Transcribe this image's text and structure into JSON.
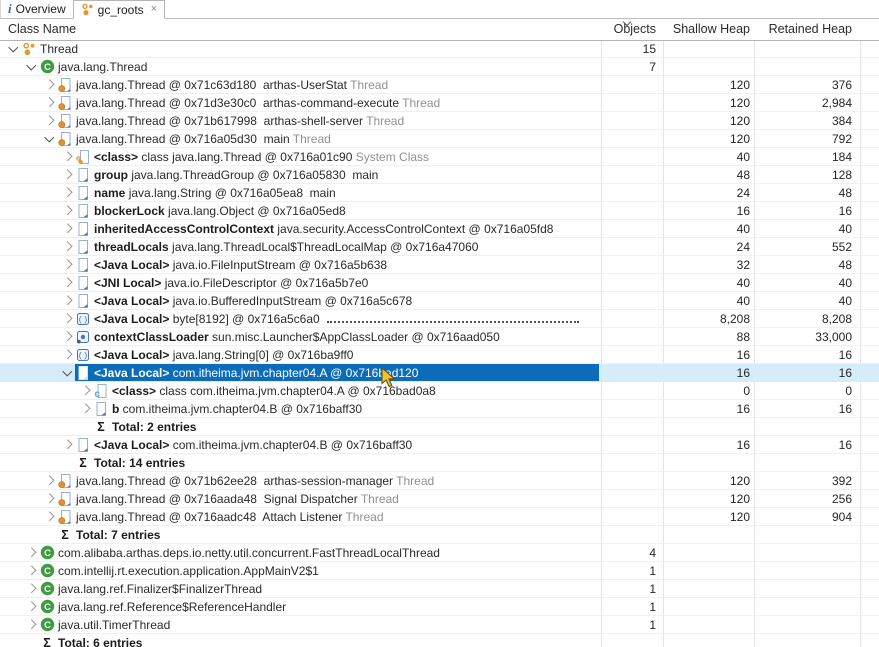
{
  "tabs": [
    {
      "label": "Overview",
      "icon": "info-icon",
      "active": false,
      "closable": false
    },
    {
      "label": "gc_roots",
      "icon": "gc-roots-icon",
      "active": true,
      "closable": true,
      "close_label": "×"
    }
  ],
  "columns": [
    {
      "label": "Class Name"
    },
    {
      "label": "Objects"
    },
    {
      "label": "Shallow Heap"
    },
    {
      "label": "Retained Heap"
    }
  ],
  "sort_indicator_column": "Objects",
  "colors": {
    "selection_dark": "#0c6cba",
    "selection_light": "#d5edfa",
    "gc_roots_orange": "#df9a33",
    "class_green": "#3f9b3f",
    "icon_blue": "#4a76b8",
    "muted_text": "#919191"
  },
  "rows": [
    {
      "level": 0,
      "expand": "expanded",
      "icon": "gc-roots",
      "segments": [
        [
          "n",
          "Thread"
        ]
      ],
      "objects": "15",
      "shallow": "",
      "retained": ""
    },
    {
      "level": 1,
      "expand": "expanded",
      "icon": "class-green",
      "segments": [
        [
          "n",
          "java.lang.Thread"
        ]
      ],
      "objects": "7",
      "shallow": "",
      "retained": ""
    },
    {
      "level": 2,
      "expand": "collapsed",
      "icon": "thread",
      "segments": [
        [
          "n",
          "java.lang.Thread @ 0x71c63d180  arthas-UserStat"
        ],
        [
          "g",
          " Thread"
        ]
      ],
      "objects": "",
      "shallow": "120",
      "retained": "376"
    },
    {
      "level": 2,
      "expand": "collapsed",
      "icon": "thread",
      "segments": [
        [
          "n",
          "java.lang.Thread @ 0x71d3e30c0  arthas-command-execute"
        ],
        [
          "g",
          " Thread"
        ]
      ],
      "objects": "",
      "shallow": "120",
      "retained": "2,984"
    },
    {
      "level": 2,
      "expand": "collapsed",
      "icon": "thread",
      "segments": [
        [
          "n",
          "java.lang.Thread @ 0x71b617998  arthas-shell-server"
        ],
        [
          "g",
          " Thread"
        ]
      ],
      "objects": "",
      "shallow": "120",
      "retained": "384"
    },
    {
      "level": 2,
      "expand": "expanded",
      "icon": "thread",
      "segments": [
        [
          "n",
          "java.lang.Thread @ 0x716a05d30  main"
        ],
        [
          "g",
          " Thread"
        ]
      ],
      "objects": "",
      "shallow": "120",
      "retained": "792"
    },
    {
      "level": 3,
      "expand": "collapsed",
      "icon": "sysclass",
      "segments": [
        [
          "b",
          "<class> "
        ],
        [
          "n",
          "class java.lang.Thread @ 0x716a01c90 "
        ],
        [
          "g",
          "System Class"
        ]
      ],
      "objects": "",
      "shallow": "40",
      "retained": "184"
    },
    {
      "level": 3,
      "expand": "collapsed",
      "icon": "object",
      "segments": [
        [
          "b",
          "group "
        ],
        [
          "n",
          "java.lang.ThreadGroup @ 0x716a05830  main"
        ]
      ],
      "objects": "",
      "shallow": "48",
      "retained": "128"
    },
    {
      "level": 3,
      "expand": "collapsed",
      "icon": "object",
      "segments": [
        [
          "b",
          "name "
        ],
        [
          "n",
          "java.lang.String @ 0x716a05ea8  main"
        ]
      ],
      "objects": "",
      "shallow": "24",
      "retained": "48"
    },
    {
      "level": 3,
      "expand": "collapsed",
      "icon": "object",
      "segments": [
        [
          "b",
          "blockerLock "
        ],
        [
          "n",
          "java.lang.Object @ 0x716a05ed8"
        ]
      ],
      "objects": "",
      "shallow": "16",
      "retained": "16"
    },
    {
      "level": 3,
      "expand": "collapsed",
      "icon": "object",
      "segments": [
        [
          "b",
          "inheritedAccessControlContext "
        ],
        [
          "n",
          "java.security.AccessControlContext @ 0x716a05fd8"
        ]
      ],
      "objects": "",
      "shallow": "40",
      "retained": "40"
    },
    {
      "level": 3,
      "expand": "collapsed",
      "icon": "object",
      "segments": [
        [
          "b",
          "threadLocals "
        ],
        [
          "n",
          "java.lang.ThreadLocal$ThreadLocalMap @ 0x716a47060"
        ]
      ],
      "objects": "",
      "shallow": "24",
      "retained": "552"
    },
    {
      "level": 3,
      "expand": "collapsed",
      "icon": "object",
      "segments": [
        [
          "b",
          "<Java Local> "
        ],
        [
          "n",
          "java.io.FileInputStream @ 0x716a5b638"
        ]
      ],
      "objects": "",
      "shallow": "32",
      "retained": "48"
    },
    {
      "level": 3,
      "expand": "collapsed",
      "icon": "object",
      "segments": [
        [
          "b",
          "<JNI Local> "
        ],
        [
          "n",
          "java.io.FileDescriptor @ 0x716a5b7e0"
        ]
      ],
      "objects": "",
      "shallow": "40",
      "retained": "40"
    },
    {
      "level": 3,
      "expand": "collapsed",
      "icon": "object",
      "segments": [
        [
          "b",
          "<Java Local> "
        ],
        [
          "n",
          "java.io.BufferedInputStream @ 0x716a5c678"
        ]
      ],
      "objects": "",
      "shallow": "40",
      "retained": "40"
    },
    {
      "level": 3,
      "expand": "collapsed",
      "icon": "array",
      "segments": [
        [
          "b",
          "<Java Local> "
        ],
        [
          "n",
          "byte[8192] @ 0x716a5c6a0 "
        ]
      ],
      "dots": true,
      "objects": "",
      "shallow": "8,208",
      "retained": "8,208"
    },
    {
      "level": 3,
      "expand": "collapsed",
      "icon": "classloader",
      "segments": [
        [
          "b",
          "contextClassLoader "
        ],
        [
          "n",
          "sun.misc.Launcher$AppClassLoader @ 0x716aad050"
        ]
      ],
      "objects": "",
      "shallow": "88",
      "retained": "33,000"
    },
    {
      "level": 3,
      "expand": "collapsed",
      "icon": "array",
      "segments": [
        [
          "b",
          "<Java Local> "
        ],
        [
          "n",
          "java.lang.String[0] @ 0x716ba9ff0"
        ]
      ],
      "objects": "",
      "shallow": "16",
      "retained": "16"
    },
    {
      "level": 3,
      "expand": "expanded",
      "icon": "object-white",
      "selected": true,
      "segments": [
        [
          "b",
          "<Java Local> "
        ],
        [
          "n",
          "com.itheima.jvm.chapter04.A @ 0x716bad120"
        ]
      ],
      "objects": "",
      "shallow": "16",
      "retained": "16"
    },
    {
      "level": 4,
      "expand": "collapsed",
      "icon": "class-blue",
      "segments": [
        [
          "b",
          "<class> "
        ],
        [
          "n",
          "class com.itheima.jvm.chapter04.A @ 0x716bad0a8"
        ]
      ],
      "objects": "",
      "shallow": "0",
      "retained": "0"
    },
    {
      "level": 4,
      "expand": "collapsed",
      "icon": "object",
      "segments": [
        [
          "b",
          "b "
        ],
        [
          "n",
          "com.itheima.jvm.chapter04.B @ 0x716baff30"
        ]
      ],
      "objects": "",
      "shallow": "16",
      "retained": "16"
    },
    {
      "level": 4,
      "expand": "none",
      "icon": "sigma",
      "segments": [
        [
          "b",
          "Total: 2 entries"
        ]
      ],
      "objects": "",
      "shallow": "",
      "retained": ""
    },
    {
      "level": 3,
      "expand": "collapsed",
      "icon": "object",
      "segments": [
        [
          "b",
          "<Java Local> "
        ],
        [
          "n",
          "com.itheima.jvm.chapter04.B @ 0x716baff30"
        ]
      ],
      "objects": "",
      "shallow": "16",
      "retained": "16"
    },
    {
      "level": 3,
      "expand": "none",
      "icon": "sigma",
      "segments": [
        [
          "b",
          "Total: 14 entries"
        ]
      ],
      "objects": "",
      "shallow": "",
      "retained": ""
    },
    {
      "level": 2,
      "expand": "collapsed",
      "icon": "thread",
      "segments": [
        [
          "n",
          "java.lang.Thread @ 0x71b62ee28  arthas-session-manager"
        ],
        [
          "g",
          " Thread"
        ]
      ],
      "objects": "",
      "shallow": "120",
      "retained": "392"
    },
    {
      "level": 2,
      "expand": "collapsed",
      "icon": "thread",
      "segments": [
        [
          "n",
          "java.lang.Thread @ 0x716aada48  Signal Dispatcher"
        ],
        [
          "g",
          " Thread"
        ]
      ],
      "objects": "",
      "shallow": "120",
      "retained": "256"
    },
    {
      "level": 2,
      "expand": "collapsed",
      "icon": "thread",
      "segments": [
        [
          "n",
          "java.lang.Thread @ 0x716aadc48  Attach Listener"
        ],
        [
          "g",
          " Thread"
        ]
      ],
      "objects": "",
      "shallow": "120",
      "retained": "904"
    },
    {
      "level": 2,
      "expand": "none",
      "icon": "sigma",
      "segments": [
        [
          "b",
          "Total: 7 entries"
        ]
      ],
      "objects": "",
      "shallow": "",
      "retained": ""
    },
    {
      "level": 1,
      "expand": "collapsed",
      "icon": "class-green",
      "segments": [
        [
          "n",
          "com.alibaba.arthas.deps.io.netty.util.concurrent.FastThreadLocalThread"
        ]
      ],
      "objects": "4",
      "shallow": "",
      "retained": ""
    },
    {
      "level": 1,
      "expand": "collapsed",
      "icon": "class-green",
      "segments": [
        [
          "n",
          "com.intellij.rt.execution.application.AppMainV2$1"
        ]
      ],
      "objects": "1",
      "shallow": "",
      "retained": ""
    },
    {
      "level": 1,
      "expand": "collapsed",
      "icon": "class-green",
      "segments": [
        [
          "n",
          "java.lang.ref.Finalizer$FinalizerThread"
        ]
      ],
      "objects": "1",
      "shallow": "",
      "retained": ""
    },
    {
      "level": 1,
      "expand": "collapsed",
      "icon": "class-green",
      "segments": [
        [
          "n",
          "java.lang.ref.Reference$ReferenceHandler"
        ]
      ],
      "objects": "1",
      "shallow": "",
      "retained": ""
    },
    {
      "level": 1,
      "expand": "collapsed",
      "icon": "class-green",
      "segments": [
        [
          "n",
          "java.util.TimerThread"
        ]
      ],
      "objects": "1",
      "shallow": "",
      "retained": ""
    },
    {
      "level": 1,
      "expand": "none",
      "icon": "sigma",
      "segments": [
        [
          "b",
          "Total: 6 entries"
        ]
      ],
      "objects": "",
      "shallow": "",
      "retained": ""
    }
  ]
}
